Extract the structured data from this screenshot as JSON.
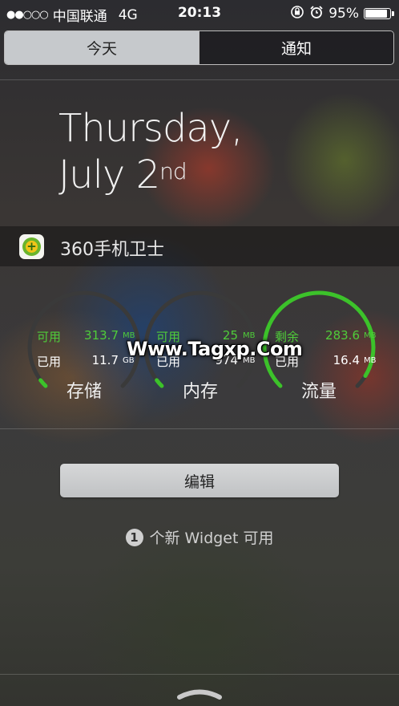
{
  "status_bar": {
    "signal_dots": "●●○○○",
    "carrier": "中国联通",
    "network": "4G",
    "time": "20:13",
    "battery_percent": "95%",
    "battery_level": 0.95,
    "icons": [
      "orientation-lock-icon",
      "alarm-icon",
      "battery-icon"
    ]
  },
  "tabs": [
    {
      "label": "今天",
      "selected": true
    },
    {
      "label": "通知",
      "selected": false
    }
  ],
  "date": {
    "line1": "Thursday,",
    "line2": "July 2",
    "suffix": "nd"
  },
  "widget": {
    "title": "360手机卫士",
    "icon": "360-security-app-icon",
    "gauges": [
      {
        "name": "存储",
        "row1_label": "可用",
        "row1_value": "313.7",
        "row1_unit": "MB",
        "row2_label": "已用",
        "row2_value": "11.7",
        "row2_unit": "GB",
        "level": 0.03
      },
      {
        "name": "内存",
        "row1_label": "可用",
        "row1_value": "25",
        "row1_unit": "MB",
        "row2_label": "已用",
        "row2_value": "974",
        "row2_unit": "MB",
        "level": 0.03
      },
      {
        "name": "流量",
        "row1_label": "剩余",
        "row1_value": "283.6",
        "row1_unit": "MB",
        "row2_label": "已用",
        "row2_value": "16.4",
        "row2_unit": "MB",
        "level": 0.95
      }
    ],
    "colors": {
      "gauge_active": "#3cc22a",
      "gauge_track": "#3a3a3a"
    }
  },
  "watermark": "Www.Tagxp.Com",
  "edit_button": "编辑",
  "new_widget": {
    "count": "1",
    "text": "个新 Widget 可用"
  }
}
